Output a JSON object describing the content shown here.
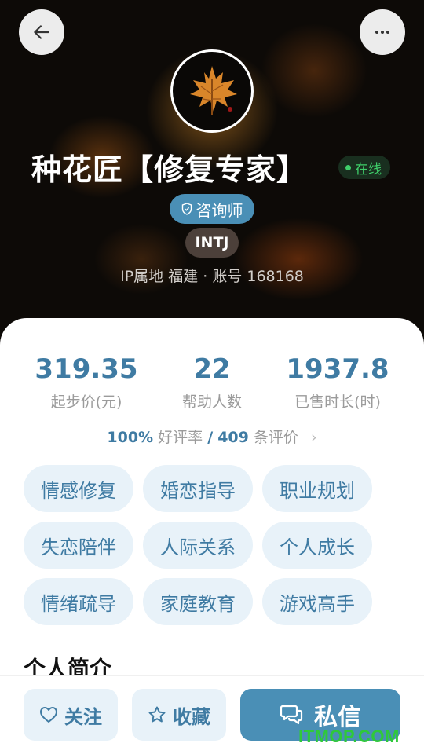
{
  "header": {
    "name": "种花匠【修复专家】",
    "status": "在线",
    "role_badge": "咨询师",
    "mbti": "INTJ",
    "ip_line": "IP属地 福建 · 账号 168168",
    "icons": {
      "back": "arrow-left-icon",
      "more": "more-dots-icon",
      "role": "shield-check-icon"
    }
  },
  "stats": [
    {
      "value": "319.35",
      "label": "起步价(元)"
    },
    {
      "value": "22",
      "label": "帮助人数"
    },
    {
      "value": "1937.8",
      "label": "已售时长(时)"
    }
  ],
  "rating": {
    "rate": "100%",
    "rate_text": "好评率",
    "sep": "/",
    "count": "409",
    "count_text": "条评价",
    "chevron": "›"
  },
  "tags": [
    "情感修复",
    "婚恋指导",
    "职业规划",
    "失恋陪伴",
    "人际关系",
    "个人成长",
    "情绪疏导",
    "家庭教育",
    "游戏高手"
  ],
  "intro": {
    "title": "个人简介"
  },
  "bottom_bar": {
    "follow": "关注",
    "favorite": "收藏",
    "message": "私信",
    "icons": {
      "follow": "heart-icon",
      "favorite": "star-icon",
      "message": "chat-bubble-icon"
    }
  },
  "watermark": "ITMOP.COM",
  "colors": {
    "accent": "#3f7ba3",
    "primary_button": "#4a8fb6",
    "tag_bg": "#e8f2f9",
    "online": "#3fcf6a"
  }
}
